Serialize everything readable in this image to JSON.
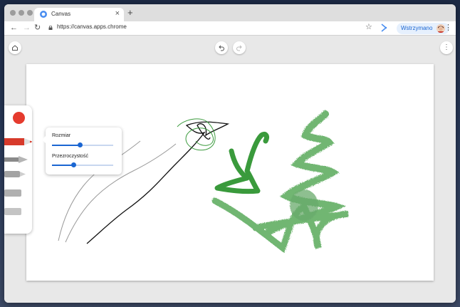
{
  "browser": {
    "tab": {
      "title": "Canvas",
      "close_icon": "close-icon"
    },
    "new_tab_icon": "plus-icon",
    "url": "https://canvas.apps.chrome",
    "profile": {
      "label": "Wstrzymano"
    }
  },
  "canvas_app": {
    "toolbar": {
      "home_icon": "home-icon",
      "undo_icon": "undo-icon",
      "redo_icon": "redo-icon",
      "menu_icon": "more-vert-icon"
    },
    "palette": {
      "selected_color": "#e53b2e",
      "tools": [
        "marker",
        "fountain-pen",
        "felt-tip",
        "chalk",
        "eraser"
      ],
      "selected_tool": "marker"
    },
    "tool_settings": {
      "size_label": "Rozmiar",
      "size_value": 0.45,
      "opacity_label": "Przezroczystość",
      "opacity_value": 0.35
    },
    "colors": {
      "accent": "#1a66d2",
      "stroke_green": "#3a9a3c",
      "stroke_black": "#111111",
      "stroke_gray": "#9a9a9a"
    }
  }
}
